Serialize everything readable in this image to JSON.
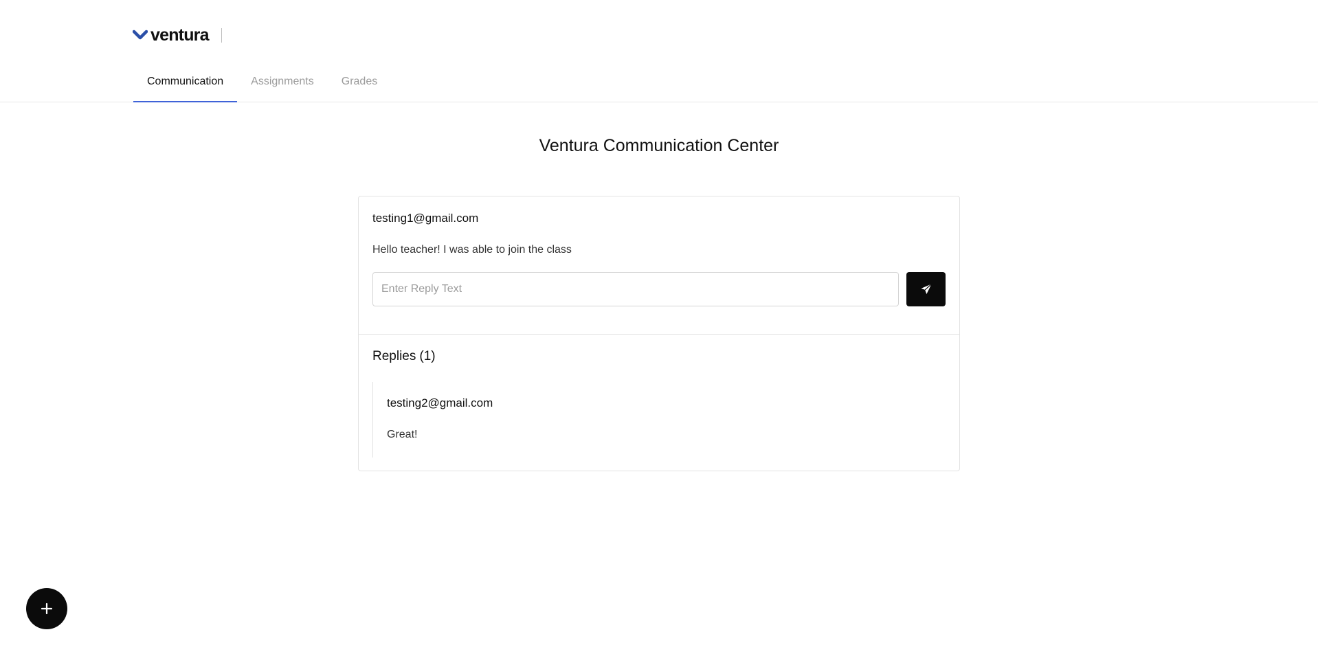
{
  "header": {
    "logo_text": "ventura",
    "logo_icon": "chevron-down-icon",
    "brand_color": "#2b4fa8"
  },
  "tabs": [
    {
      "label": "Communication",
      "active": true
    },
    {
      "label": "Assignments",
      "active": false
    },
    {
      "label": "Grades",
      "active": false
    }
  ],
  "page": {
    "title": "Ventura Communication Center"
  },
  "post": {
    "author": "testing1@gmail.com",
    "message": "Hello teacher! I was able to join the class",
    "reply_input": {
      "value": "",
      "placeholder": "Enter Reply Text"
    },
    "send_icon": "paper-plane-icon"
  },
  "replies": {
    "heading": "Replies",
    "count_text": "(1)",
    "items": [
      {
        "author": "testing2@gmail.com",
        "message": "Great!"
      }
    ]
  },
  "fab": {
    "icon": "plus-icon"
  },
  "colors": {
    "accent": "#3f63d8",
    "button_bg": "#0b0b0b",
    "muted_text": "#9b9b9b"
  }
}
